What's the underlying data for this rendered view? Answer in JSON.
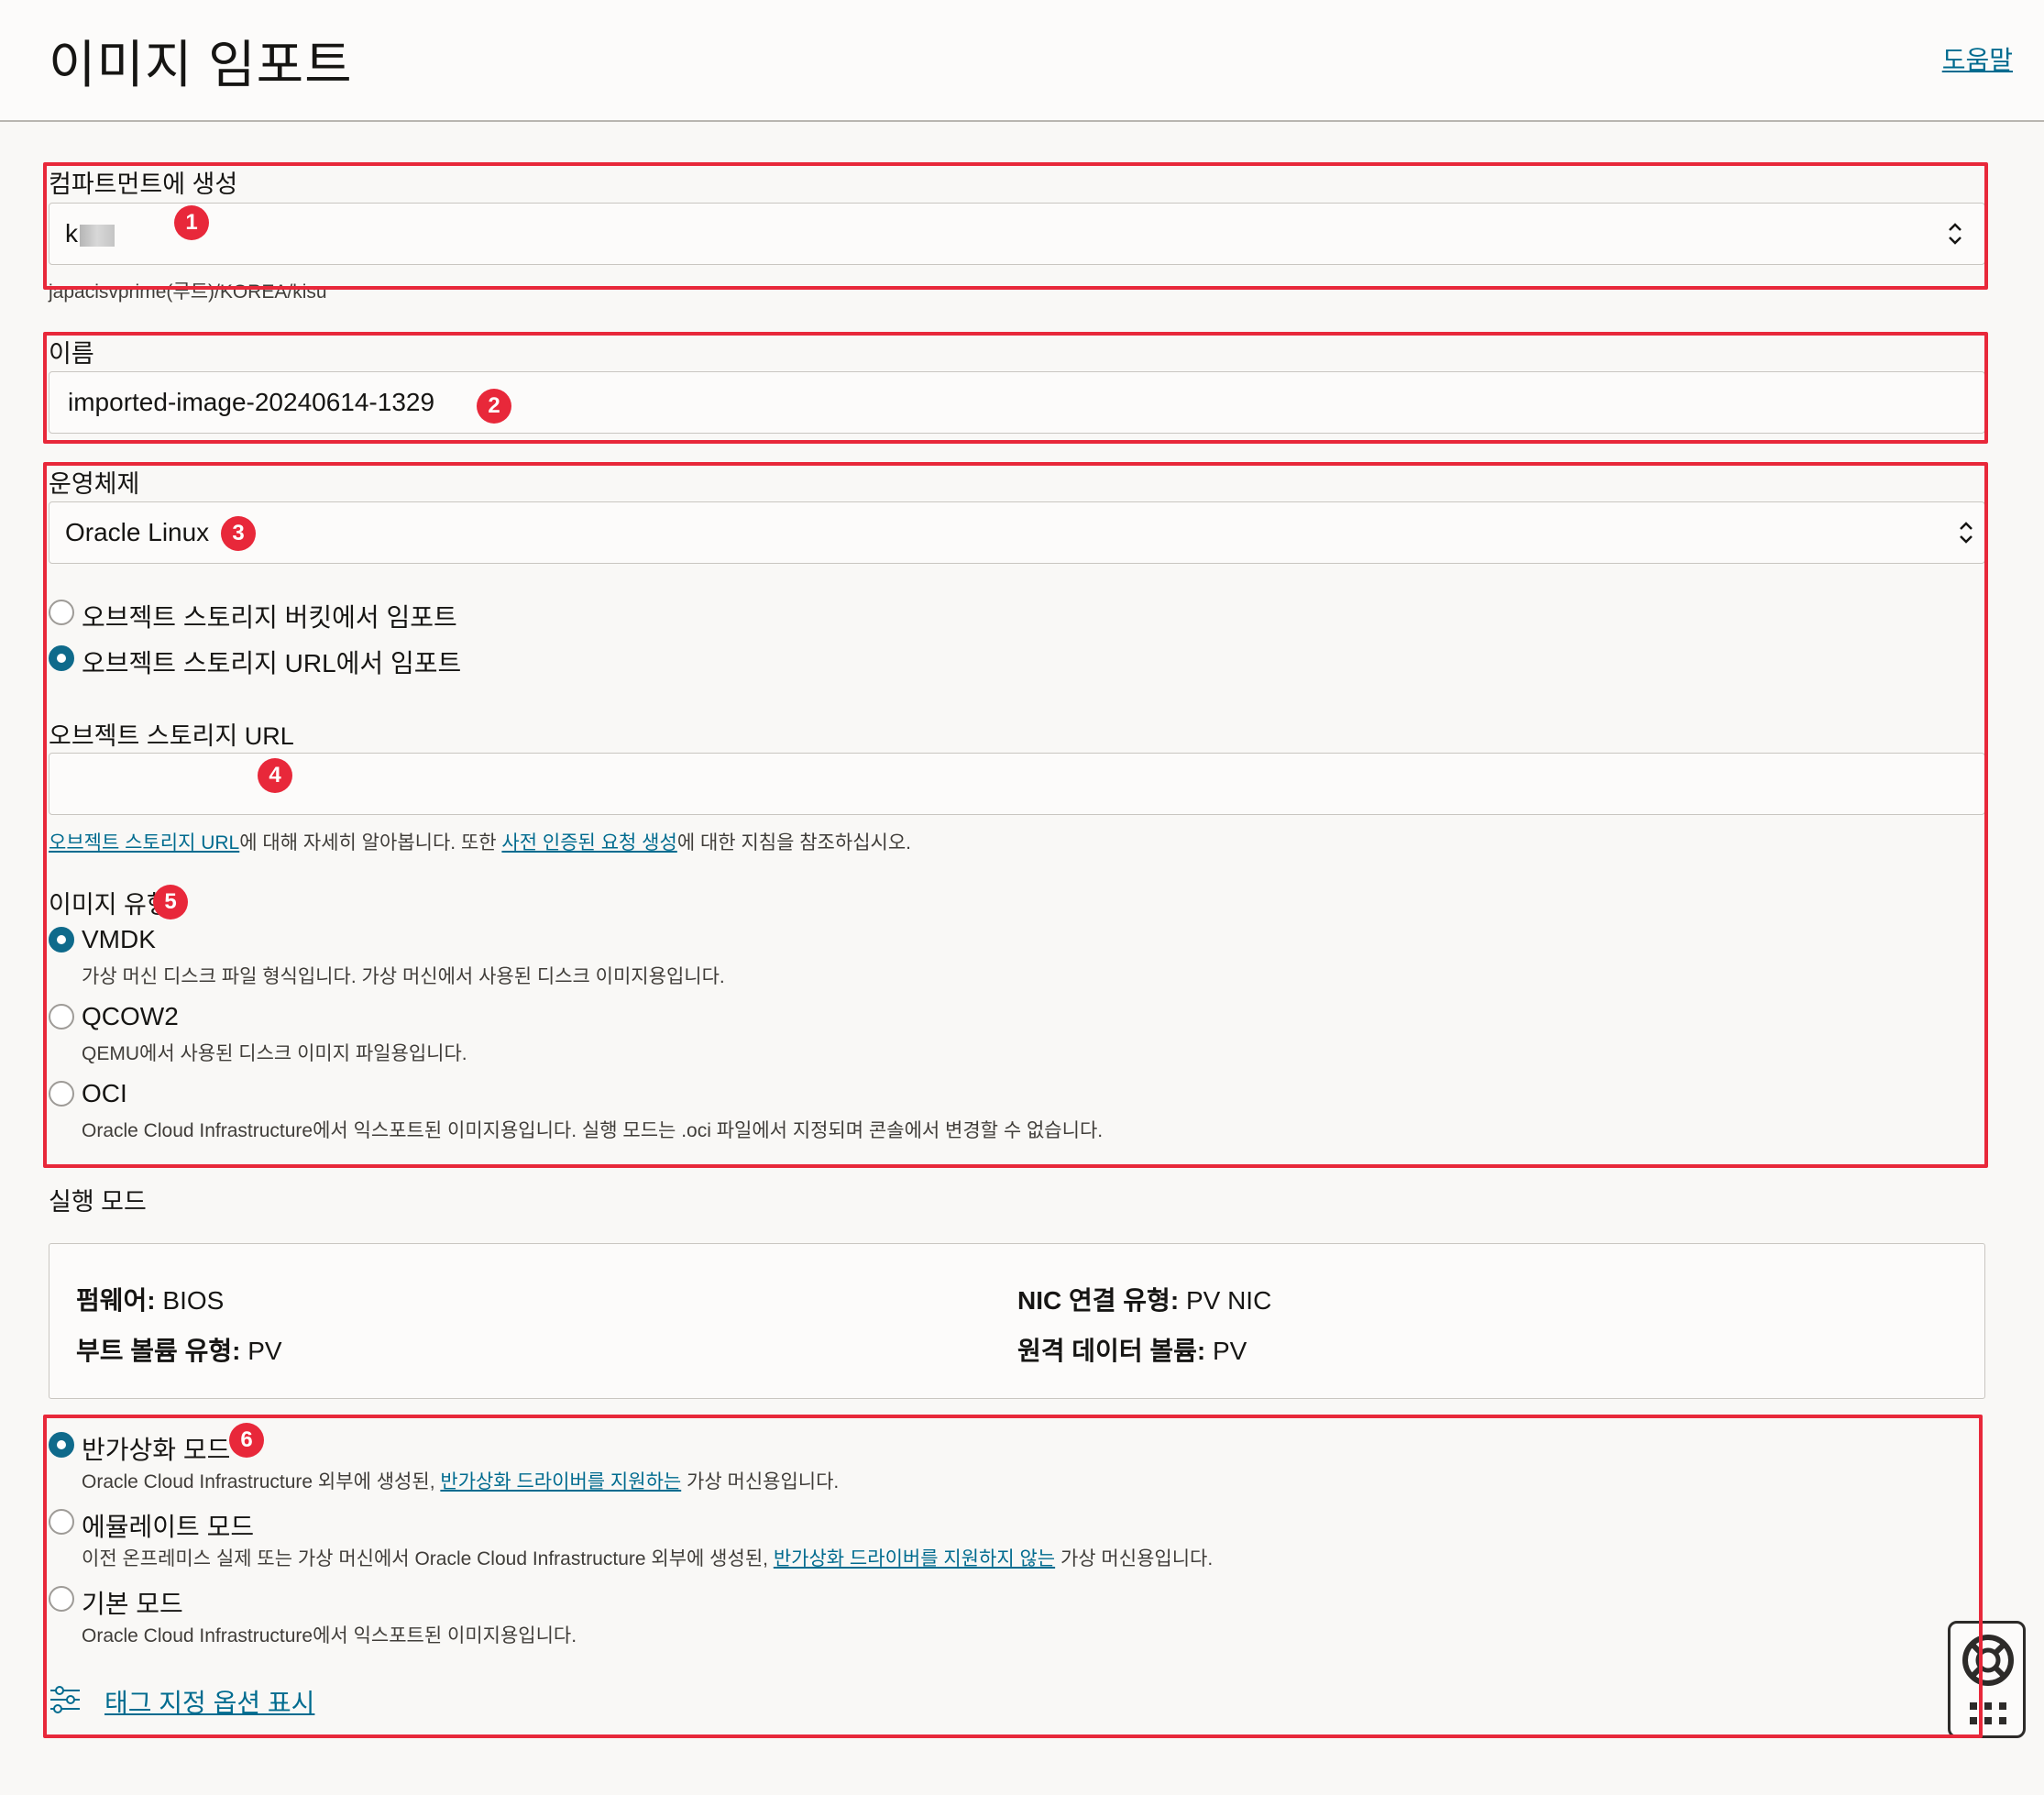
{
  "header": {
    "title": "이미지 임포트",
    "help": "도움말"
  },
  "compartment": {
    "label": "컴파트먼트에 생성",
    "value": "k",
    "path": "japacisvprime(루트)/KOREA/kisu"
  },
  "name": {
    "label": "이름",
    "value": "imported-image-20240614-1329"
  },
  "os": {
    "label": "운영체제",
    "value": "Oracle Linux",
    "source_options": [
      {
        "label": "오브젝트 스토리지 버킷에서 임포트",
        "selected": false
      },
      {
        "label": "오브젝트 스토리지 URL에서 임포트",
        "selected": true
      }
    ]
  },
  "url": {
    "label": "오브젝트 스토리지 URL",
    "value": "",
    "hint_link1": "오브젝트 스토리지 URL",
    "hint_mid": "에 대해 자세히 알아봅니다. 또한 ",
    "hint_link2": "사전 인증된 요청 생성",
    "hint_end": "에 대한 지침을 참조하십시오."
  },
  "image_type": {
    "label": "이미지 유형",
    "options": [
      {
        "label": "VMDK",
        "desc": "가상 머신 디스크 파일 형식입니다. 가상 머신에서 사용된 디스크 이미지용입니다.",
        "selected": true
      },
      {
        "label": "QCOW2",
        "desc": "QEMU에서 사용된 디스크 이미지 파일용입니다.",
        "selected": false
      },
      {
        "label": "OCI",
        "desc": "Oracle Cloud Infrastructure에서 익스포트된 이미지용입니다. 실행 모드는 .oci 파일에서 지정되며 콘솔에서 변경할 수 없습니다.",
        "selected": false
      }
    ]
  },
  "launch_mode": {
    "label": "실행 모드",
    "firmware_key": "펌웨어:",
    "firmware_val": "BIOS",
    "boot_key": "부트 볼륨 유형:",
    "boot_val": "PV",
    "nic_key": "NIC 연결 유형:",
    "nic_val": "PV NIC",
    "remote_key": "원격 데이터 볼륨:",
    "remote_val": "PV"
  },
  "modes": {
    "paravirt": {
      "label": "반가상화 모드",
      "desc_pre": "Oracle Cloud Infrastructure 외부에 생성된, ",
      "desc_link": "반가상화 드라이버를 지원하는",
      "desc_post": " 가상 머신용입니다.",
      "selected": true
    },
    "emulated": {
      "label": "에뮬레이트 모드",
      "desc_pre": "이전 온프레미스 실제 또는 가상 머신에서 Oracle Cloud Infrastructure 외부에 생성된, ",
      "desc_link": "반가상화 드라이버를 지원하지 않는",
      "desc_post": " 가상 머신용입니다.",
      "selected": false
    },
    "native": {
      "label": "기본 모드",
      "desc": "Oracle Cloud Infrastructure에서 익스포트된 이미지용입니다.",
      "selected": false
    }
  },
  "tags_link": "태그 지정 옵션 표시",
  "badges": [
    "1",
    "2",
    "3",
    "4",
    "5",
    "6"
  ],
  "colors": {
    "accent": "#006b8f",
    "radio": "#0f6a8b",
    "annotation": "#e8283a"
  }
}
